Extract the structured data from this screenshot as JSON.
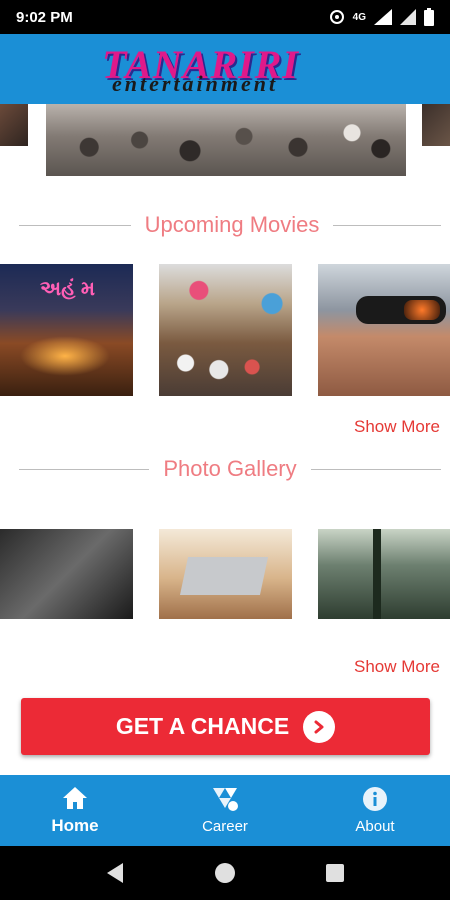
{
  "status_bar": {
    "time": "9:02 PM",
    "network": "4G"
  },
  "header": {
    "logo_main": "TANARIRI",
    "logo_sub": "entertainment"
  },
  "upcoming": {
    "title": "Upcoming Movies",
    "show_more": "Show More",
    "poster_caption": "અહં મ"
  },
  "gallery": {
    "title": "Photo Gallery",
    "show_more": "Show More"
  },
  "cta": {
    "label": "GET A CHANCE"
  },
  "bottom_nav": {
    "items": [
      {
        "label": "Home",
        "icon": "home-icon",
        "active": true
      },
      {
        "label": "Career",
        "icon": "career-icon",
        "active": false
      },
      {
        "label": "About",
        "icon": "info-icon",
        "active": false
      }
    ]
  },
  "colors": {
    "primary": "#1b8fd6",
    "accent": "#ec2a36",
    "section_title": "#ef7c82",
    "link": "#e53935"
  }
}
